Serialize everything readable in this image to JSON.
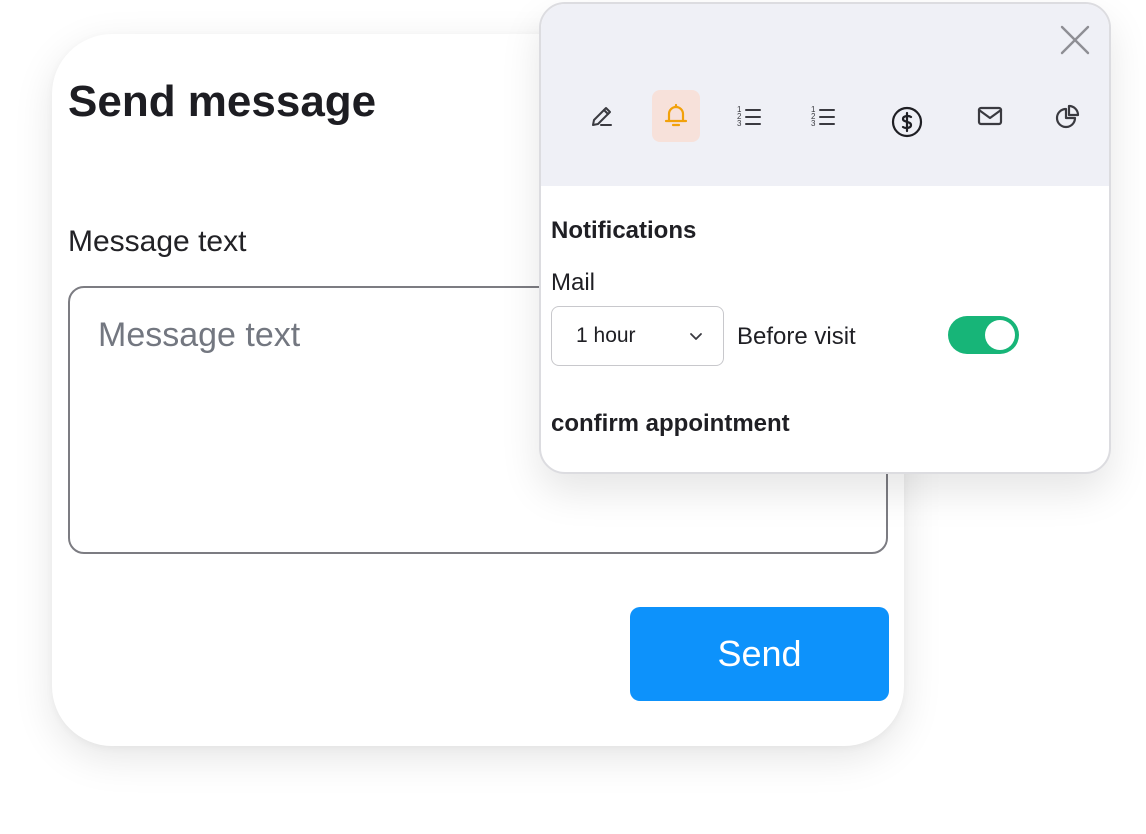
{
  "dialog": {
    "title": "Send message",
    "message_label": "Message text",
    "message_placeholder": "Message text",
    "message_value": "",
    "send_label": "Send"
  },
  "popup": {
    "toolbar": [
      {
        "icon": "pencil-icon",
        "active": false
      },
      {
        "icon": "bell-icon",
        "active": true
      },
      {
        "icon": "ordered-list-icon",
        "active": false
      },
      {
        "icon": "ordered-list-icon",
        "active": false
      },
      {
        "icon": "dollar-icon",
        "active": false
      },
      {
        "icon": "mail-icon",
        "active": false
      },
      {
        "icon": "pie-chart-icon",
        "active": false
      }
    ],
    "section_title": "Notifications",
    "channel_label": "Mail",
    "timing_value": "1 hour",
    "timing_suffix": "Before visit",
    "toggle_on": true,
    "confirm_label": "confirm appointment"
  },
  "colors": {
    "primary": "#0d92fb",
    "toggle": "#17b578",
    "active_icon": "#f2a10a",
    "active_icon_bg": "#f7e1da",
    "header_bg": "#eff0f6"
  }
}
